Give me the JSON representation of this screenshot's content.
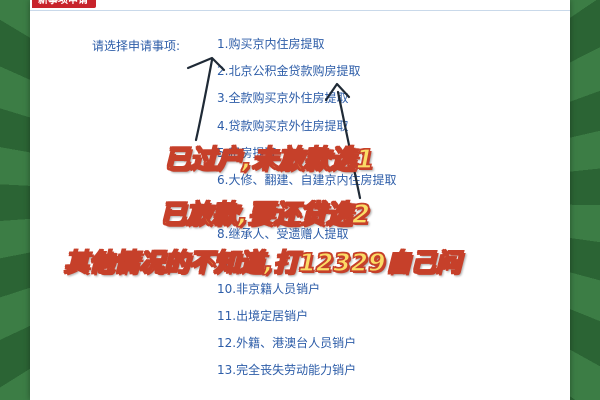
{
  "header": {
    "tab_title": "新事项申请"
  },
  "form": {
    "prompt_label": "请选择申请事项:",
    "items": [
      "1.购买京内住房提取",
      "2.北京公积金贷款购房提取",
      "3.全款购买京外住房提取",
      "4.贷款购买京外住房提取",
      "5.租房提取",
      "6.大修、翻建、自建京内住房提取",
      "7.",
      "8.继承人、受遗赠人提取",
      "9.",
      "10.非京籍人员销户",
      "11.出境定居销户",
      "12.外籍、港澳台人员销户",
      "13.完全丧失劳动能力销户"
    ]
  },
  "annotations": {
    "note1": "已过户,未放款选1",
    "note2": "已放款,要还贷选2",
    "note3": "其他情况的不知道,打12329自己问"
  },
  "colors": {
    "background": "#2f6b3a",
    "link_text": "#2d5da8",
    "tab": "#c8232b",
    "annotation_fill": "#fbdc66",
    "annotation_stroke": "#c6402a"
  }
}
